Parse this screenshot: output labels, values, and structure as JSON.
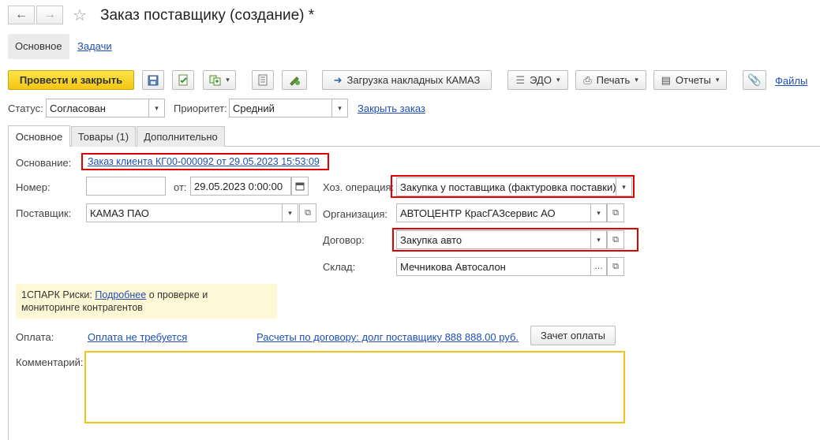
{
  "window": {
    "title": "Заказ поставщику (создание) *"
  },
  "top_tabs": [
    {
      "label": "Основное"
    },
    {
      "label": "Задачи"
    }
  ],
  "toolbar": {
    "post_close": "Провести и закрыть",
    "load_kamaz": "Загрузка накладных КАМАЗ",
    "edo": "ЭДО",
    "print": "Печать",
    "reports": "Отчеты",
    "files": "Файлы"
  },
  "status_row": {
    "status_label": "Статус:",
    "status_value": "Согласован",
    "priority_label": "Приоритет:",
    "priority_value": "Средний",
    "close_order": "Закрыть заказ"
  },
  "form_tabs": [
    {
      "label": "Основное"
    },
    {
      "label": "Товары (1)"
    },
    {
      "label": "Дополнительно"
    }
  ],
  "form": {
    "basis_label": "Основание:",
    "basis_value": "Заказ клиента КГ00-000092 от 29.05.2023 15:53:09",
    "number_label": "Номер:",
    "number_value": "",
    "date_label": "от:",
    "date_value": "29.05.2023  0:00:00",
    "operation_label": "Хоз. операция:",
    "operation_value": "Закупка у поставщика (фактуровка поставки)",
    "supplier_label": "Поставщик:",
    "supplier_value": "КАМАЗ ПАО",
    "org_label": "Организация:",
    "org_value": "АВТОЦЕНТР КрасГАЗсервис АО",
    "contract_label": "Договор:",
    "contract_value": "Закупка авто",
    "warehouse_label": "Склад:",
    "warehouse_value": "Мечникова Автосалон",
    "spark_prefix": "1СПАРК Риски:",
    "spark_link": "Подробнее",
    "spark_suffix_1": "о проверке и",
    "spark_suffix_2": "мониторинге контрагентов",
    "payment_label": "Оплата:",
    "payment_value": "Оплата не требуется",
    "settlements": "Расчеты по договору: долг поставщику 888 888.00 руб.",
    "offset_button": "Зачет оплаты",
    "comment_label": "Комментарий:",
    "comment_value": ""
  },
  "colors": {
    "accent_yellow": "#f5cd1c",
    "highlight_red": "#e00000",
    "link_blue": "#1f4fb5"
  }
}
